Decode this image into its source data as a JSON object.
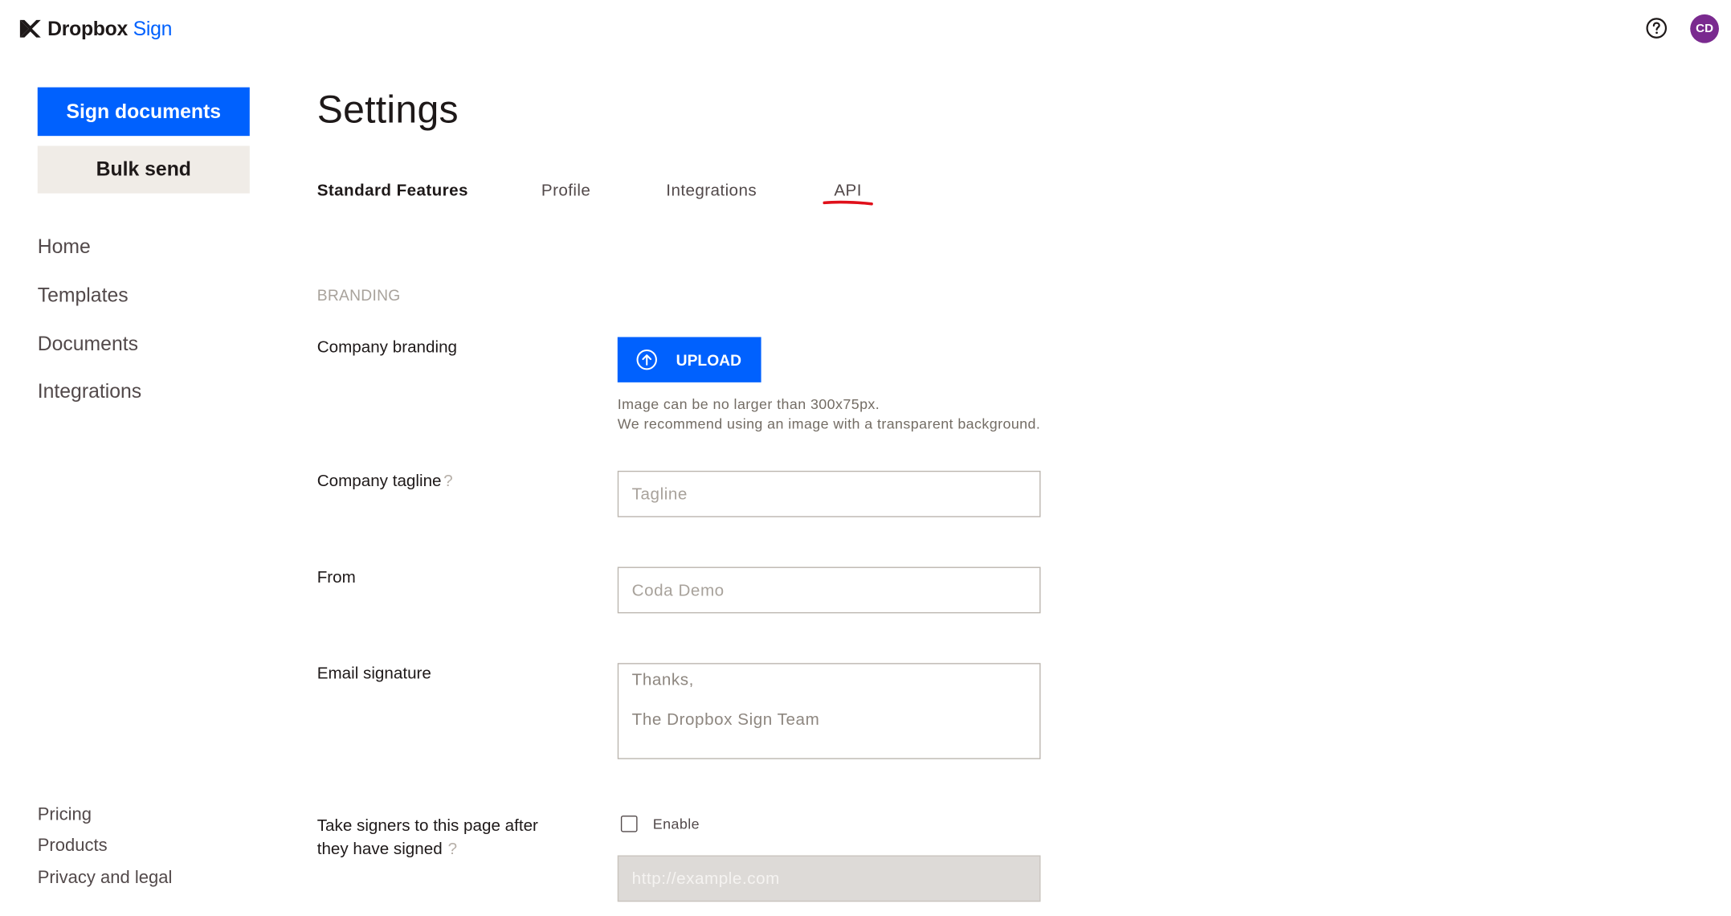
{
  "brand": {
    "name_bold": "Dropbox",
    "name_light": "Sign",
    "accent_color": "#0061fe",
    "logo_icon": "dropbox-sign-logo-icon"
  },
  "header": {
    "help_icon": "question-circle-icon",
    "avatar_initials": "CD",
    "avatar_color": "#7a2a8f"
  },
  "sidebar": {
    "primary_button": "Sign documents",
    "secondary_button": "Bulk send",
    "nav": [
      "Home",
      "Templates",
      "Documents",
      "Integrations"
    ],
    "footer": [
      "Pricing",
      "Products",
      "Privacy and legal"
    ]
  },
  "main": {
    "title": "Settings",
    "tabs": [
      {
        "label": "Standard Features",
        "active": true
      },
      {
        "label": "Profile",
        "active": false
      },
      {
        "label": "Integrations",
        "active": false
      },
      {
        "label": "API",
        "active": false
      }
    ],
    "annotation_color": "#e0101a",
    "section_branding": "BRANDING",
    "company_branding": {
      "label": "Company branding",
      "upload_label": "UPLOAD",
      "upload_icon": "upload-arrow-circle-icon",
      "hint_line1": "Image can be no larger than 300x75px.",
      "hint_line2": "We recommend using an image with a transparent background."
    },
    "company_tagline": {
      "label": "Company tagline",
      "help_mark": "?",
      "placeholder": "Tagline",
      "value": ""
    },
    "from": {
      "label": "From",
      "placeholder": "Coda Demo",
      "value": ""
    },
    "email_signature": {
      "label": "Email signature",
      "line1": "Thanks,",
      "line2": "The Dropbox Sign Team"
    },
    "redirect": {
      "label_line1": "Take signers to this page after",
      "label_line2": "they have signed",
      "help_mark": "?",
      "checkbox_label": "Enable",
      "checked": false,
      "placeholder": "http://example.com"
    }
  }
}
